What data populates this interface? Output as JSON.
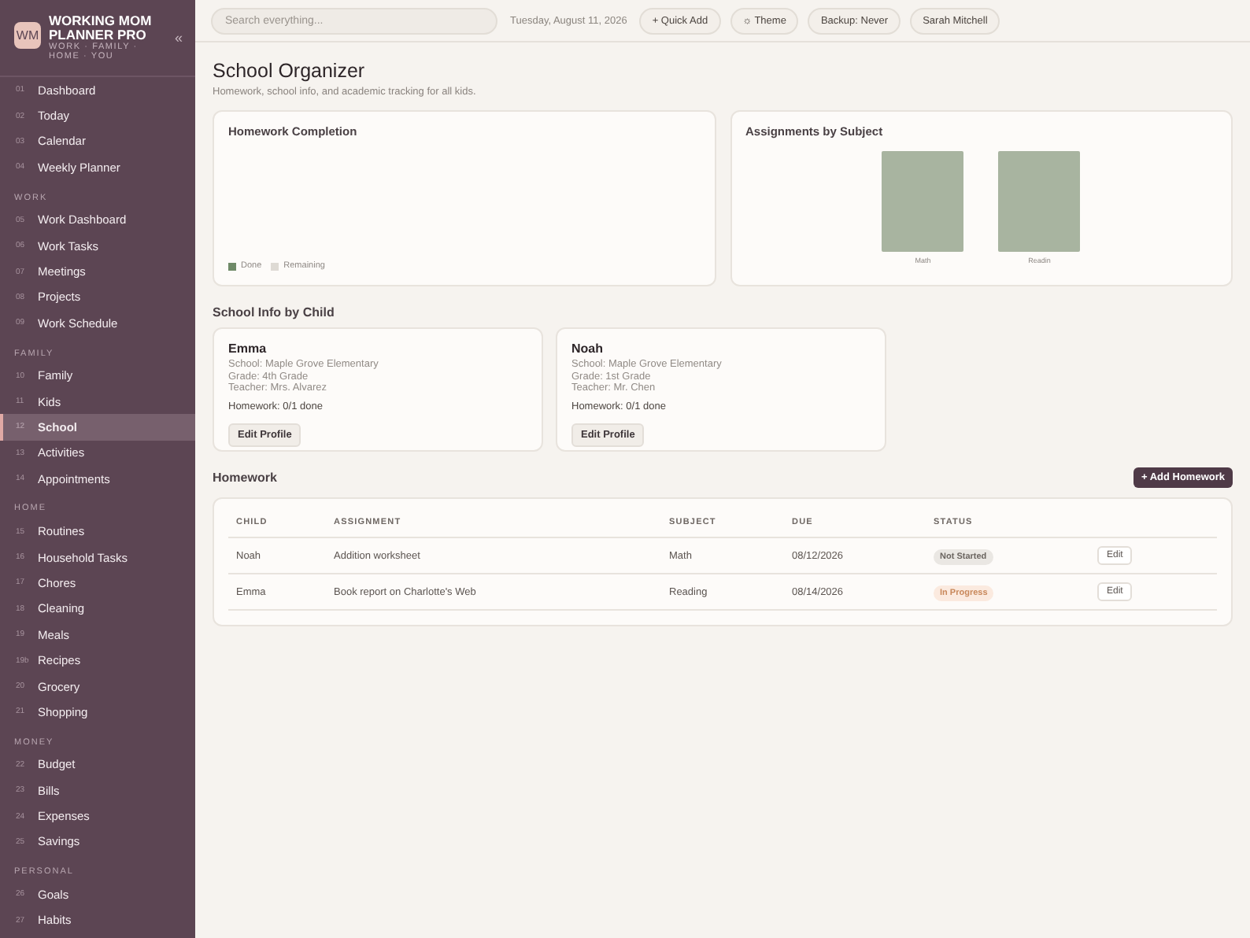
{
  "brand": {
    "logo": "WM",
    "title": "WORKING MOM PLANNER PRO",
    "subtitle": "WORK · FAMILY · HOME · YOU",
    "collapse": "«"
  },
  "sidebar": {
    "sections": [
      {
        "items": [
          {
            "num": "01",
            "label": "Dashboard",
            "selected": false
          },
          {
            "num": "02",
            "label": "Today",
            "selected": false
          },
          {
            "num": "03",
            "label": "Calendar",
            "selected": false
          },
          {
            "num": "04",
            "label": "Weekly Planner",
            "selected": false
          }
        ]
      },
      {
        "label": "WORK",
        "items": [
          {
            "num": "05",
            "label": "Work Dashboard",
            "selected": false
          },
          {
            "num": "06",
            "label": "Work Tasks",
            "selected": false
          },
          {
            "num": "07",
            "label": "Meetings",
            "selected": false
          },
          {
            "num": "08",
            "label": "Projects",
            "selected": false
          },
          {
            "num": "09",
            "label": "Work Schedule",
            "selected": false
          }
        ]
      },
      {
        "label": "FAMILY",
        "items": [
          {
            "num": "10",
            "label": "Family",
            "selected": false
          },
          {
            "num": "11",
            "label": "Kids",
            "selected": false
          },
          {
            "num": "12",
            "label": "School",
            "selected": true
          },
          {
            "num": "13",
            "label": "Activities",
            "selected": false
          },
          {
            "num": "14",
            "label": "Appointments",
            "selected": false
          }
        ]
      },
      {
        "label": "HOME",
        "items": [
          {
            "num": "15",
            "label": "Routines",
            "selected": false
          },
          {
            "num": "16",
            "label": "Household Tasks",
            "selected": false
          },
          {
            "num": "17",
            "label": "Chores",
            "selected": false
          },
          {
            "num": "18",
            "label": "Cleaning",
            "selected": false
          },
          {
            "num": "19",
            "label": "Meals",
            "selected": false
          },
          {
            "num": "19b",
            "label": "Recipes",
            "selected": false
          },
          {
            "num": "20",
            "label": "Grocery",
            "selected": false
          },
          {
            "num": "21",
            "label": "Shopping",
            "selected": false
          }
        ]
      },
      {
        "label": "MONEY",
        "items": [
          {
            "num": "22",
            "label": "Budget",
            "selected": false
          },
          {
            "num": "23",
            "label": "Bills",
            "selected": false
          },
          {
            "num": "24",
            "label": "Expenses",
            "selected": false
          },
          {
            "num": "25",
            "label": "Savings",
            "selected": false
          }
        ]
      },
      {
        "label": "PERSONAL",
        "items": [
          {
            "num": "26",
            "label": "Goals",
            "selected": false
          },
          {
            "num": "27",
            "label": "Habits",
            "selected": false
          }
        ]
      }
    ]
  },
  "topbar": {
    "search": {
      "placeholder": "Search everything..."
    },
    "date": "Tuesday, August 11, 2026",
    "buttons": [
      "+ Quick Add",
      "☼ Theme",
      "Backup: Never",
      "Sarah Mitchell"
    ]
  },
  "page": {
    "title": "School Organizer",
    "subtitle": "Homework, school info, and academic tracking for all kids."
  },
  "completion": {
    "title": "Homework Completion",
    "legend": [
      {
        "label": "Done",
        "color": "#6f8a68"
      },
      {
        "label": "Remaining",
        "color": "#dedad4"
      }
    ]
  },
  "subjects": {
    "title": "Assignments by Subject",
    "categories": [
      "Math",
      "Readin"
    ]
  },
  "school_info": {
    "title": "School Info by Child",
    "children": [
      {
        "name": "Emma",
        "school": "School: Maple Grove Elementary",
        "grade": "Grade: 4th Grade",
        "teacher": "Teacher: Mrs. Alvarez",
        "homework": "Homework: 0/1 done",
        "button": "Edit Profile"
      },
      {
        "name": "Noah",
        "school": "School: Maple Grove Elementary",
        "grade": "Grade: 1st Grade",
        "teacher": "Teacher: Mr. Chen",
        "homework": "Homework: 0/1 done",
        "button": "Edit Profile"
      }
    ]
  },
  "homework": {
    "title": "Homework",
    "add_button": "+ Add Homework",
    "columns": [
      "CHILD",
      "ASSIGNMENT",
      "SUBJECT",
      "DUE",
      "STATUS"
    ],
    "rows": [
      {
        "child": "Noah",
        "assignment": "Addition worksheet",
        "subject": "Math",
        "due": "08/12/2026",
        "status": "Not Started",
        "kind": "not-started",
        "action": "Edit"
      },
      {
        "child": "Emma",
        "assignment": "Book report on Charlotte's Web",
        "subject": "Reading",
        "due": "08/14/2026",
        "status": "In Progress",
        "kind": "in-progress",
        "action": "Edit"
      }
    ]
  }
}
